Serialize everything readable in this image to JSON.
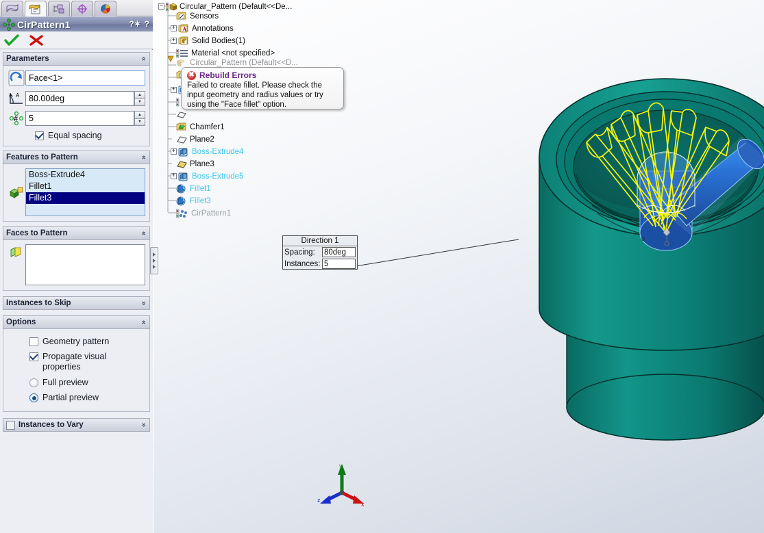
{
  "panel": {
    "tabs": [
      {
        "name": "feature-manager-tab",
        "icon": "feature-manager-icon",
        "active": false
      },
      {
        "name": "property-manager-tab",
        "icon": "property-manager-icon",
        "active": true
      },
      {
        "name": "configuration-manager-tab",
        "icon": "configuration-manager-icon",
        "active": false
      },
      {
        "name": "dimxpert-manager-tab",
        "icon": "dimxpert-icon",
        "active": false
      },
      {
        "name": "display-manager-tab",
        "icon": "display-manager-icon",
        "active": false
      }
    ],
    "title": "CirPattern1",
    "title_icon": "circular-pattern-icon",
    "help_icons": [
      "help-options-icon",
      "help-icon"
    ],
    "ok_label": "✔",
    "cancel_label": "✖",
    "groups": {
      "parameters": {
        "label": "Parameters",
        "collapse_glyph": "«",
        "axis_field": {
          "value": "Face<1>",
          "icon": "pattern-axis-icon"
        },
        "angle_field": {
          "value": "80.00deg",
          "icon": "angle-icon"
        },
        "instances_field": {
          "value": "5",
          "icon": "number-of-instances-icon"
        },
        "equal_spacing": {
          "label": "Equal spacing",
          "checked": true
        }
      },
      "features_to_pattern": {
        "label": "Features to Pattern",
        "collapse_glyph": "«",
        "icon": "features-to-pattern-icon",
        "items": [
          {
            "label": "Boss-Extrude4",
            "selected": false
          },
          {
            "label": "Fillet1",
            "selected": false
          },
          {
            "label": "Fillet3",
            "selected": true
          }
        ]
      },
      "faces_to_pattern": {
        "label": "Faces to Pattern",
        "collapse_glyph": "«",
        "icon": "faces-to-pattern-icon",
        "items": []
      },
      "instances_to_skip": {
        "label": "Instances to Skip",
        "collapse_glyph": "»"
      },
      "options": {
        "label": "Options",
        "collapse_glyph": "«",
        "geometry_pattern": {
          "label": "Geometry pattern",
          "checked": false
        },
        "propagate_visual": {
          "label": "Propagate visual properties",
          "checked": true
        },
        "full_preview": {
          "label": "Full preview",
          "selected": false
        },
        "partial_preview": {
          "label": "Partial preview",
          "selected": true
        }
      },
      "instances_to_vary": {
        "label": "Instances to Vary",
        "collapse_glyph": "»",
        "checked": false
      }
    }
  },
  "tree": {
    "nodes": [
      {
        "label": "Circular_Pattern  (Default<<De...",
        "icon": "part-icon",
        "indent": 0,
        "expander": "-",
        "style": "normal"
      },
      {
        "label": "Sensors",
        "icon": "sensors-icon",
        "indent": 1,
        "expander": "",
        "style": "normal"
      },
      {
        "label": "Annotations",
        "icon": "annotations-icon",
        "indent": 1,
        "expander": "+",
        "style": "normal"
      },
      {
        "label": "Solid Bodies(1)",
        "icon": "solid-bodies-icon",
        "indent": 1,
        "expander": "+",
        "style": "normal"
      },
      {
        "label": "Material <not specified>",
        "icon": "material-icon",
        "indent": 1,
        "expander": "",
        "style": "normal"
      },
      {
        "label": "Circular_Pattern  (Default<<D...",
        "icon": "part-icon",
        "indent": 1,
        "expander": "",
        "style": "faded"
      },
      {
        "label": "Chamfer1",
        "icon": "chamfer-icon",
        "indent": 1,
        "expander": "",
        "style": "normal"
      },
      {
        "label": "Plane2",
        "icon": "plane-icon",
        "indent": 1,
        "expander": "",
        "style": "normal"
      },
      {
        "label": "Boss-Extrude4",
        "icon": "boss-extrude-icon",
        "indent": 1,
        "expander": "+",
        "style": "cyan"
      },
      {
        "label": "Plane3",
        "icon": "plane-gold-icon",
        "indent": 1,
        "expander": "",
        "style": "normal"
      },
      {
        "label": "Boss-Extrude5",
        "icon": "boss-extrude-icon",
        "indent": 1,
        "expander": "+",
        "style": "cyan"
      },
      {
        "label": "Fillet1",
        "icon": "fillet-icon",
        "indent": 1,
        "expander": "",
        "style": "cyan"
      },
      {
        "label": "Fillet3",
        "icon": "fillet-icon",
        "indent": 1,
        "expander": "",
        "style": "cyan"
      },
      {
        "label": "CirPattern1",
        "icon": "circular-pattern-tree-icon",
        "indent": 1,
        "expander": "",
        "style": "grey"
      }
    ]
  },
  "tooltip": {
    "title": "Rebuild Errors",
    "icon": "error-icon",
    "lines": [
      "Failed to create fillet.  Please check the",
      "input geometry and radius values or try",
      "using the \"Face fillet\" option."
    ]
  },
  "callout": {
    "title": "Direction 1",
    "spacing_label": "Spacing:",
    "spacing_value": "80deg",
    "instances_label": "Instances:",
    "instances_value": "5"
  },
  "triad": {
    "x_label": "x",
    "y_label": "y",
    "z_label": "z",
    "x_color": "#cc1111",
    "y_color": "#0e7a15",
    "z_color": "#1a2ecc"
  },
  "colors": {
    "model_teal": "#0d7d72",
    "model_teal_dark": "#0a5f58",
    "preview_yellow": "#f2f20a",
    "preview_blue": "#1a5fc8",
    "selected_blue": "#000080",
    "tree_cyan": "#3ec8f0"
  }
}
